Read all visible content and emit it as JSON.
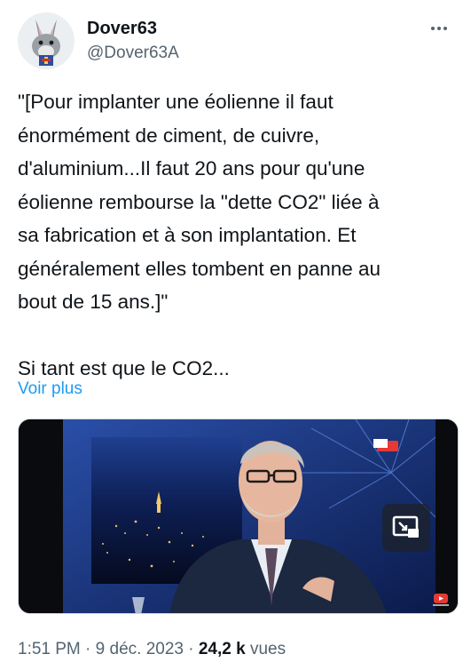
{
  "author": {
    "display_name": "Dover63",
    "handle": "@Dover63A",
    "avatar_icon": "rabbit-avatar-icon"
  },
  "tweet": {
    "text": "\"[Pour implanter une éolienne il faut\nénormément de ciment, de cuivre,\nd'aluminium...Il faut 20 ans pour qu'une\néolienne rembourse la \"dette CO2\" liée à\nsa fabrication et à son implantation. Et\ngénéralement elles tombent en panne au\nbout de 15 ans.]\"\n\nSi tant est que le CO2...",
    "show_more": "Voir plus"
  },
  "media": {
    "type": "video",
    "channel_logo": "TVL",
    "pip_icon": "picture-in-picture-icon",
    "corner_badge": "youtube-icon"
  },
  "meta": {
    "time": "1:51 PM",
    "separator": "·",
    "date": "9 déc. 2023",
    "views_count": "24,2 k",
    "views_label": "vues"
  },
  "colors": {
    "link": "#1d9bf0",
    "secondary_text": "#536471",
    "primary_text": "#0f1419"
  }
}
